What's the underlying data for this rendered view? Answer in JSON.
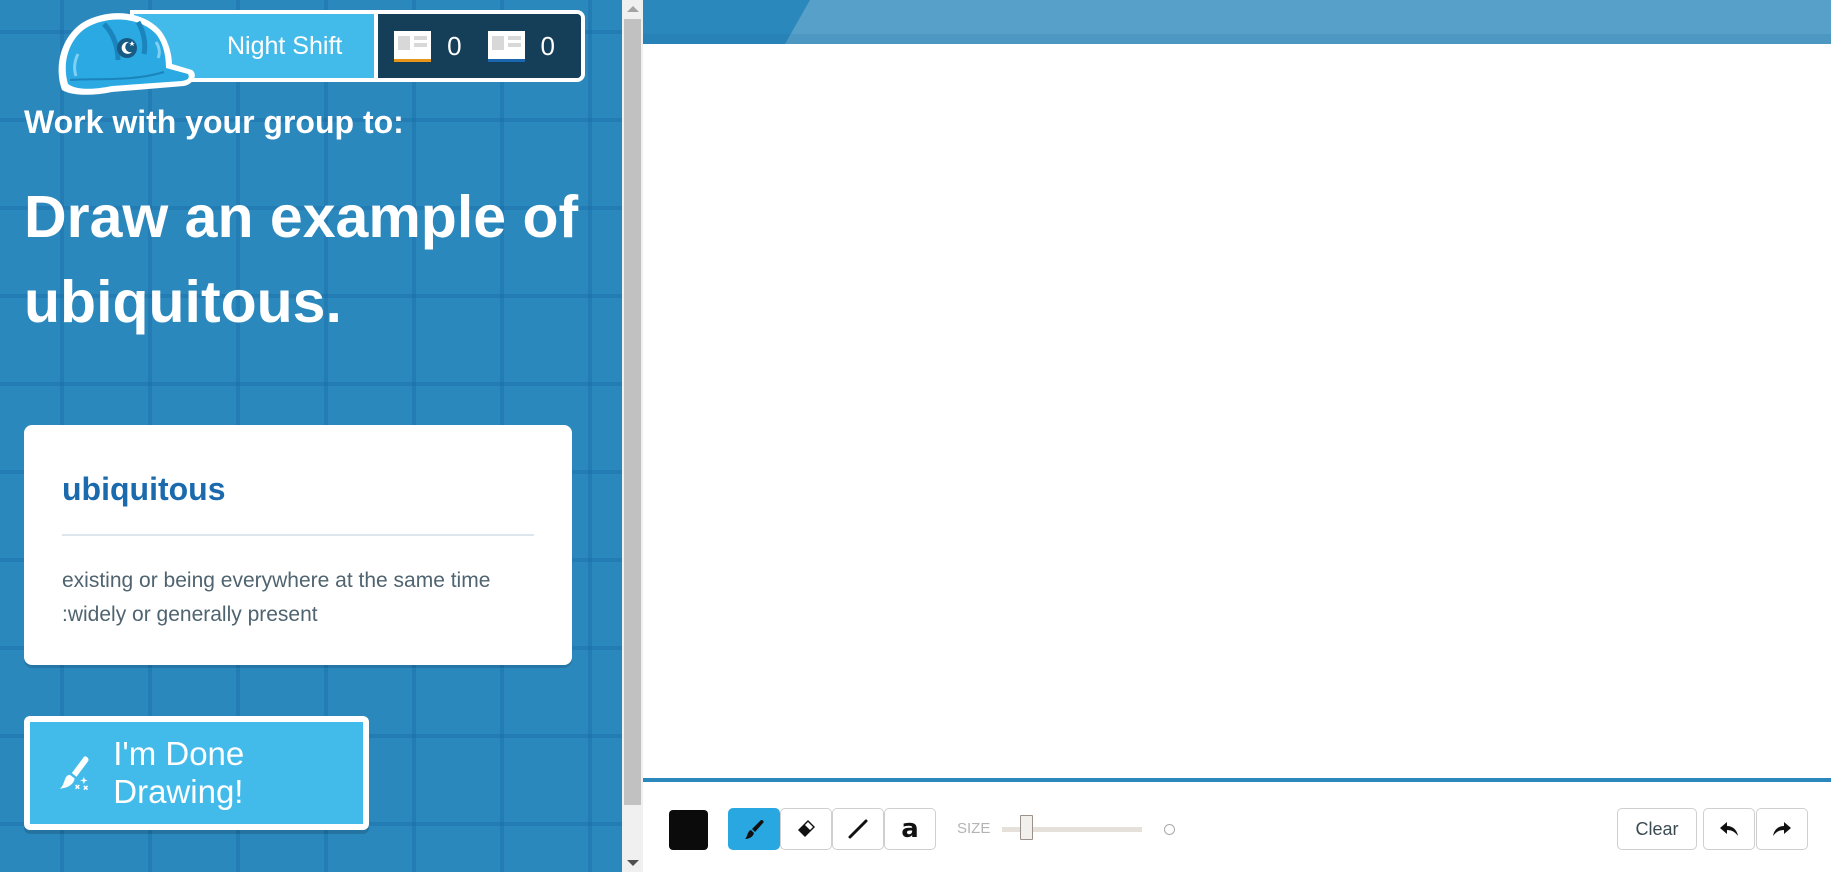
{
  "header": {
    "team_name": "Night Shift",
    "stats": [
      {
        "icon": "card-icon",
        "value": "0",
        "accent": "#e8961b"
      },
      {
        "icon": "card-icon",
        "value": "0",
        "accent": "#1a67b0"
      }
    ]
  },
  "prompt": {
    "label": "Work with your group to:",
    "title": "Draw an example of ubiquitous."
  },
  "word_card": {
    "word": "ubiquitous",
    "definition": "existing or being everywhere at the same time :widely or generally present"
  },
  "done_button": {
    "label": "I'm Done Drawing!",
    "icon": "brush-sparkle-icon"
  },
  "toolbar": {
    "current_color": "#0b0b0b",
    "tools": [
      {
        "name": "brush",
        "icon": "brush-icon",
        "active": true
      },
      {
        "name": "eraser",
        "icon": "eraser-icon",
        "active": false
      },
      {
        "name": "line",
        "icon": "line-icon",
        "active": false
      },
      {
        "name": "text",
        "icon": "text-icon",
        "label": "a",
        "active": false
      }
    ],
    "size_label": "SIZE",
    "size_value_fraction": 0.15,
    "clear_label": "Clear",
    "undo_icon": "undo-icon",
    "redo_icon": "redo-icon"
  },
  "colors": {
    "panel_bg": "#2b88bd",
    "accent": "#43bbea",
    "word_color": "#1a6aad",
    "stats_bg": "#153f58"
  }
}
